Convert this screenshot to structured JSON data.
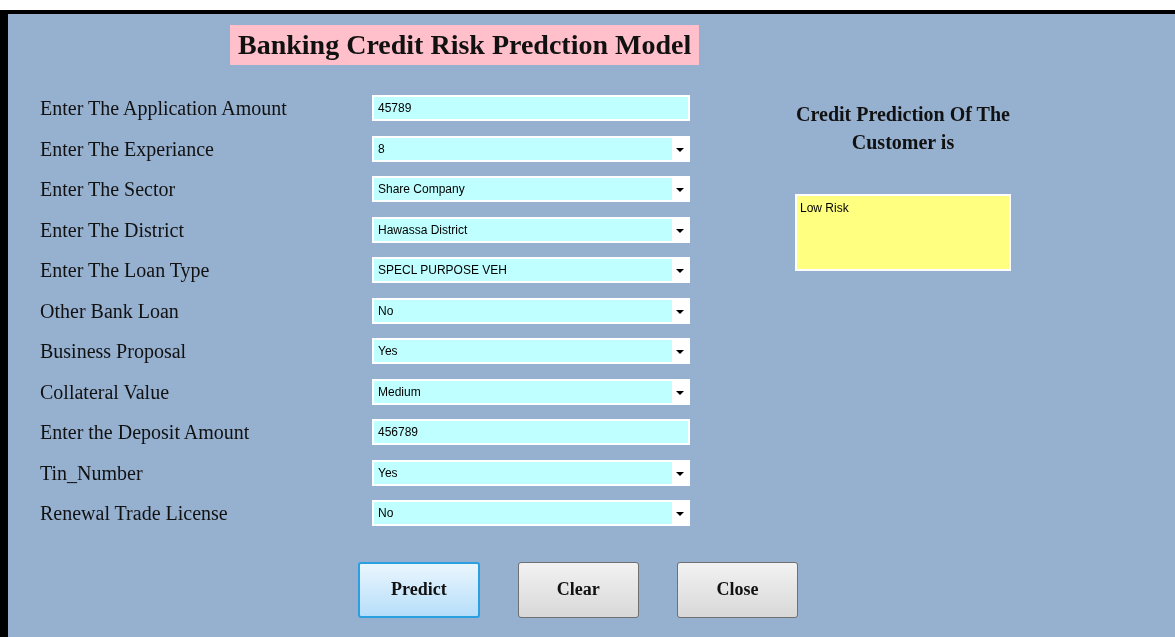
{
  "title": "Banking Credit Risk Predction Model",
  "fields": [
    {
      "label": "Enter The Application Amount",
      "kind": "text",
      "value": "45789"
    },
    {
      "label": "Enter The Experiance",
      "kind": "dropdown",
      "value": "8"
    },
    {
      "label": "Enter The Sector",
      "kind": "dropdown",
      "value": "Share Company"
    },
    {
      "label": "Enter The District",
      "kind": "dropdown",
      "value": "Hawassa District"
    },
    {
      "label": "Enter The Loan Type",
      "kind": "dropdown",
      "value": "SPECL PURPOSE VEH"
    },
    {
      "label": "Other Bank Loan",
      "kind": "dropdown",
      "value": "No"
    },
    {
      "label": "Business Proposal",
      "kind": "dropdown",
      "value": "Yes"
    },
    {
      "label": "Collateral Value",
      "kind": "dropdown",
      "value": "Medium"
    },
    {
      "label": "Enter the Deposit Amount",
      "kind": "text",
      "value": "456789"
    },
    {
      "label": "Tin_Number",
      "kind": "dropdown",
      "value": "Yes"
    },
    {
      "label": "Renewal Trade License",
      "kind": "dropdown",
      "value": "No"
    }
  ],
  "result": {
    "heading": "Credit Prediction Of The Customer is",
    "value": "Low Risk"
  },
  "buttons": [
    {
      "label": "Predict",
      "focused": true
    },
    {
      "label": "Clear",
      "focused": false
    },
    {
      "label": "Close",
      "focused": false
    }
  ]
}
